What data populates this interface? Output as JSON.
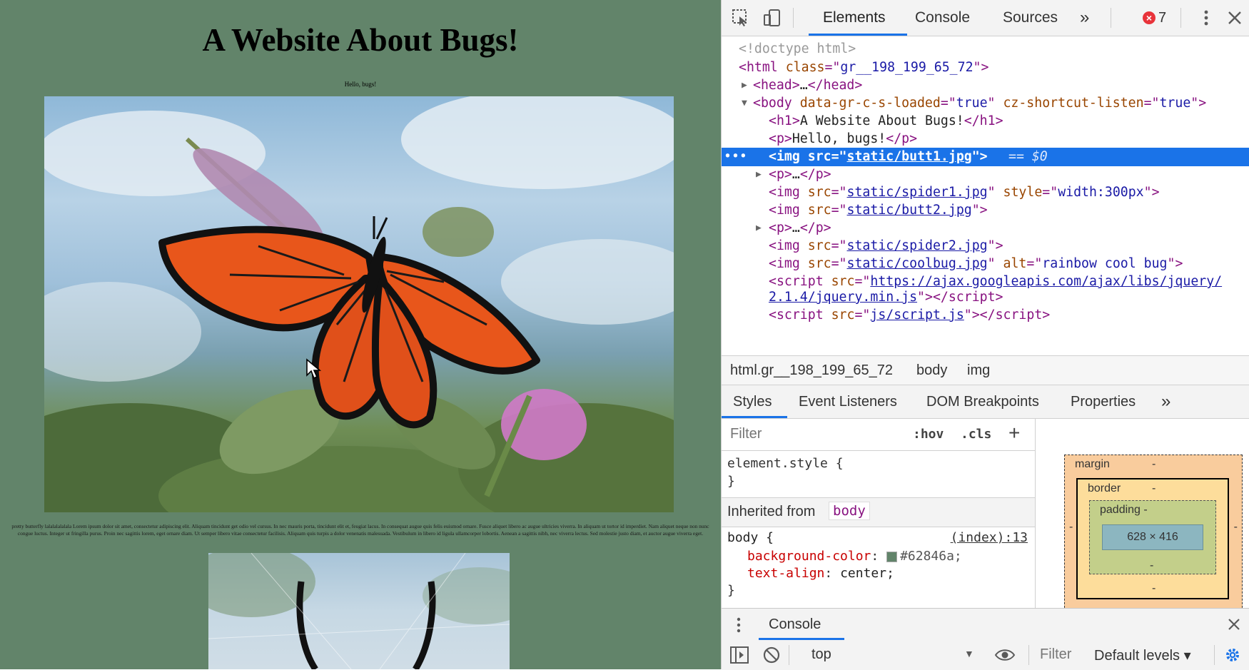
{
  "page": {
    "title": "A Website About Bugs!",
    "hello": "Hello, bugs!",
    "lorem": "pretty butterfly lalalalalalala Lorem ipsum dolor sit amet, consectetur adipiscing elit. Aliquam tincidunt get odio vel cursus. In nec mauris porta, tincidunt elit et, feugiat lacus. In consequat augue quis felis euismod ornare. Fusce aliquet libero ac augue ultricies viverra. In aliquam ut tortor id imperdiet. Nam aliquet neque non nunc congue luctus. Integer ut fringilla purus. Proin nec sagittis lorem, eget ornare diam. Ut semper libero vitae consectetur facilisis. Aliquam quis turpis a dolor venenatis malesuada. Vestibulum in libero id ligula ullamcorper lobortis. Aenean a sagittis nibh, nec viverra lectus. Sed molestie justo diam, et auctor augue viverra eget.",
    "background": "#62846a"
  },
  "devtools": {
    "tabs": [
      "Elements",
      "Console",
      "Sources"
    ],
    "more_tabs": "»",
    "error_count": "7",
    "dom": {
      "doctype": "<!doctype html>",
      "html_tag": "html",
      "html_class_attr": "class",
      "html_class": "gr__198_199_65_72",
      "head": "head",
      "body_tag": "body",
      "body_attr1": "data-gr-c-s-loaded",
      "body_val1": "true",
      "body_attr2": "cz-shortcut-listen",
      "body_val2": "true",
      "h1_text": "A Website About Bugs!",
      "p_text": "Hello, bugs!",
      "img1_src": "static/butt1.jpg",
      "selected_marker": "== $0",
      "img2_src": "static/spider1.jpg",
      "img2_style": "width:300px",
      "img3_src": "static/butt2.jpg",
      "img4_src": "static/spider2.jpg",
      "img5_src": "static/coolbug.jpg",
      "img5_alt": "rainbow cool bug",
      "script1_src_a": "https://ajax.googleapis.com/ajax/libs/jquery/",
      "script1_src_b": "2.1.4/jquery.min.js",
      "script2_src": "js/script.js"
    },
    "breadcrumb": [
      "html.gr__198_199_65_72",
      "body",
      "img"
    ],
    "sub_tabs": [
      "Styles",
      "Event Listeners",
      "DOM Breakpoints",
      "Properties"
    ],
    "styles": {
      "filter_placeholder": "Filter",
      "hov": ":hov",
      "cls": ".cls",
      "plus": "+",
      "element_style": "element.style {",
      "close_brace": "}",
      "inherited_label": "Inherited from",
      "inherited_from": "body",
      "body_selector": "body {",
      "source": "(index):13",
      "prop1": "background-color",
      "val1": "#62846a;",
      "prop2": "text-align",
      "val2": "center;"
    },
    "box_model": {
      "margin_label": "margin",
      "border_label": "border",
      "padding_label": "padding -",
      "dash": "-",
      "content_size": "628 × 416"
    },
    "drawer": {
      "title": "Console",
      "context": "top",
      "filter_placeholder": "Filter",
      "levels": "Default levels ▾"
    }
  }
}
